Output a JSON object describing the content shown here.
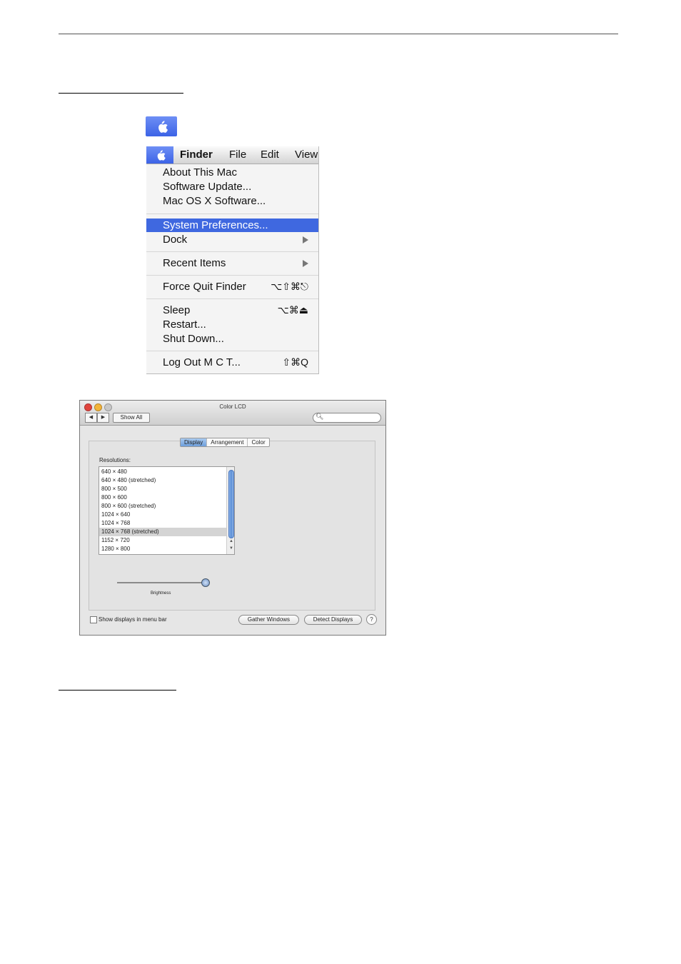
{
  "menu": {
    "bar": {
      "app": "Finder",
      "items": [
        "File",
        "Edit",
        "View"
      ]
    },
    "items": [
      {
        "label": "About This Mac"
      },
      {
        "label": "Software Update..."
      },
      {
        "label": "Mac OS X Software..."
      },
      {
        "label": "System Preferences...",
        "highlighted": true
      },
      {
        "label": "Dock",
        "submenu": true
      },
      {
        "label": "Recent Items",
        "submenu": true
      },
      {
        "label": "Force Quit Finder",
        "shortcut": "⌥⇧⌘⎋"
      },
      {
        "label": "Sleep",
        "shortcut": "⌥⌘⏏"
      },
      {
        "label": "Restart..."
      },
      {
        "label": "Shut Down..."
      },
      {
        "label": "Log Out M C T...",
        "shortcut": "⇧⌘Q"
      }
    ]
  },
  "window": {
    "title": "Color LCD",
    "nav_back": "◀",
    "nav_forward": "▶",
    "show_all": "Show All",
    "search_value": "",
    "tabs": [
      "Display",
      "Arrangement",
      "Color"
    ],
    "active_tab": "Display",
    "resolutions_label": "Resolutions:",
    "resolutions": [
      "640 × 480",
      "640 × 480 (stretched)",
      "800 × 500",
      "800 × 600",
      "800 × 600 (stretched)",
      "1024 × 640",
      "1024 × 768",
      "1024 × 768 (stretched)",
      "1152 × 720",
      "1280 × 800"
    ],
    "selected_resolution": "1024 × 768 (stretched)",
    "brightness_label": "Brightness",
    "brightness_level": 0.95,
    "show_displays_label": "Show displays in menu bar",
    "show_displays_checked": false,
    "gather_windows": "Gather Windows",
    "detect_displays": "Detect Displays",
    "help": "?"
  },
  "colors": {
    "menu_highlight": "#3f68e0",
    "close_button": "#e0443c",
    "minimize_button": "#f2b43a",
    "zoom_button": "#c8c8c8"
  }
}
